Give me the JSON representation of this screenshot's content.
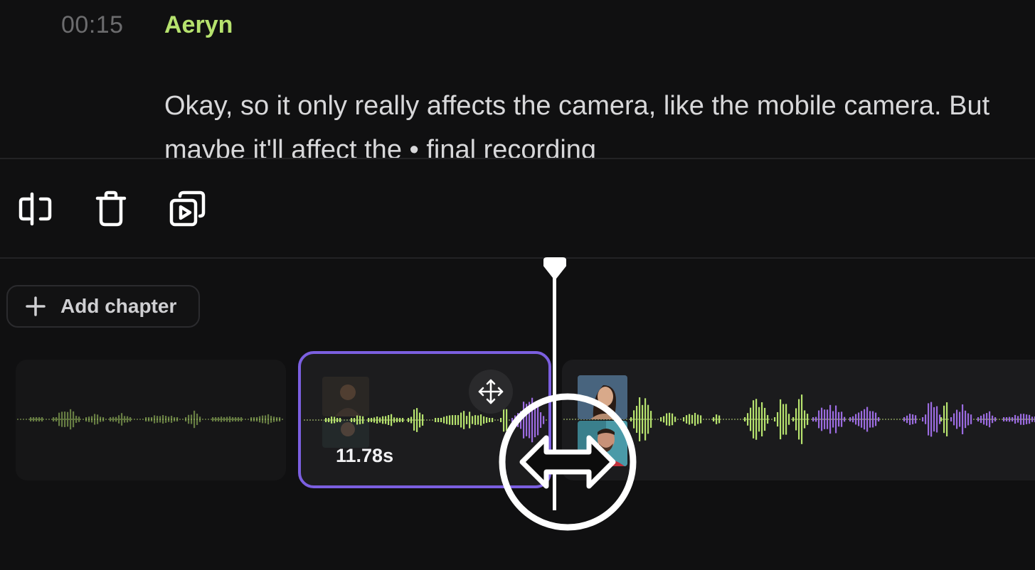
{
  "transcript": {
    "timestamp": "00:15",
    "speaker": "Aeryn",
    "text": "Okay, so it only really affects the camera, like the mobile camera. But maybe it'll affect the • final recording"
  },
  "toolbar": {
    "icons": [
      "split-icon",
      "trash-icon",
      "duplicate-clip-icon"
    ]
  },
  "timeline": {
    "add_chapter_label": "Add chapter",
    "selected_clip_duration": "11.78s",
    "colors": {
      "selection_border": "#7b5fe0",
      "speaker_a_wave": "#b6e26e",
      "speaker_b_wave": "#9b6be0"
    }
  }
}
